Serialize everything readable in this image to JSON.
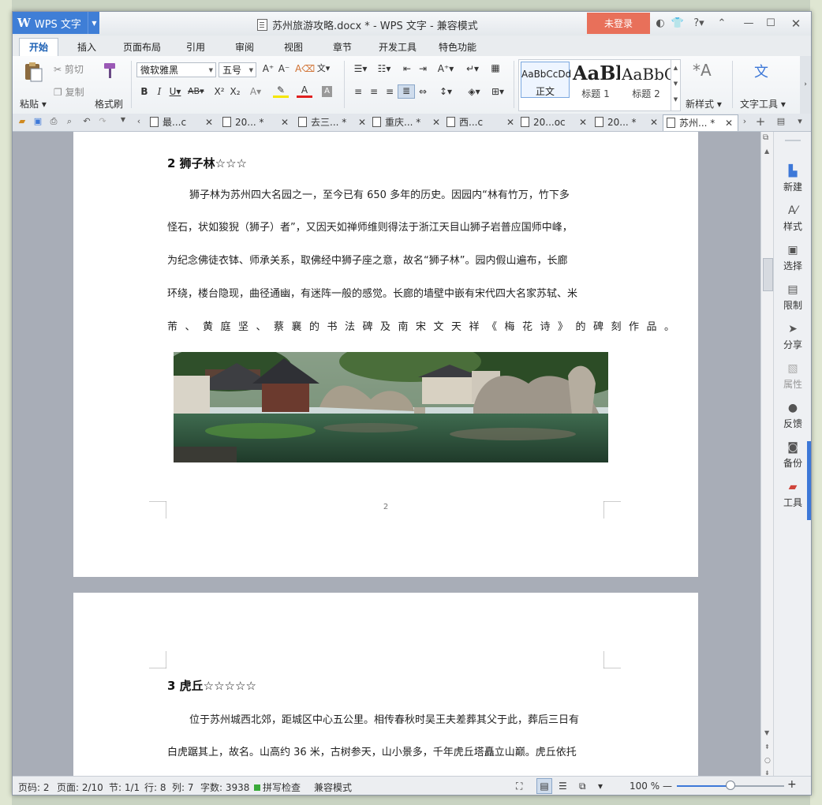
{
  "app": {
    "logo": "W",
    "name": "WPS 文字",
    "title": "苏州旅游攻略.docx * - WPS 文字 - 兼容模式",
    "login": "未登录"
  },
  "menu": {
    "tabs": [
      "开始",
      "插入",
      "页面布局",
      "引用",
      "审阅",
      "视图",
      "章节",
      "开发工具",
      "特色功能"
    ]
  },
  "ribbon": {
    "paste": "粘贴",
    "cut": "剪切",
    "copy": "复制",
    "format_painter": "格式刷",
    "font_name": "微软雅黑",
    "font_size": "五号",
    "styles": [
      {
        "preview": "AaBbCcDd",
        "name": "正文"
      },
      {
        "preview": "AaBb",
        "name": "标题 1"
      },
      {
        "preview": "AaBbC",
        "name": "标题 2"
      }
    ],
    "new_style": "新样式",
    "text_tools": "文字工具"
  },
  "doc_tabs": [
    {
      "label": "最...c"
    },
    {
      "label": "20... *"
    },
    {
      "label": "去三... *"
    },
    {
      "label": "重庆... *"
    },
    {
      "label": "西...c"
    },
    {
      "label": "20...oc"
    },
    {
      "label": "20... *"
    },
    {
      "label": "苏州... *",
      "active": true
    }
  ],
  "document": {
    "section2": {
      "heading": "2 狮子林☆☆☆",
      "lines": [
        "狮子林为苏州四大名园之一，至今已有 650 多年的历史。因园内“林有竹万，竹下多",
        "怪石，状如狻猊（狮子）者”，又因天如禅师维则得法于浙江天目山狮子岩普应国师中峰，",
        "为纪念佛徒衣钵、师承关系，取佛经中狮子座之意，故名“狮子林”。园内假山遍布，长廊",
        "环绕，楼台隐现，曲径通幽，有迷阵一般的感觉。长廊的墙壁中嵌有宋代四大名家苏轼、米",
        "芾、黄庭坚、蔡襄的书法碑及南宋文天祥《梅花诗》的碑刻作品。"
      ]
    },
    "page_number": "2",
    "section3": {
      "heading": "3 虎丘☆☆☆☆☆",
      "lines": [
        "位于苏州城西北郊，距城区中心五公里。相传春秋时吴王夫差葬其父于此，葬后三日有",
        "白虎踞其上，故名。山高约 36 米，古树参天，山小景多，千年虎丘塔矗立山巅。虎丘依托"
      ]
    }
  },
  "right_panel": [
    "新建",
    "样式",
    "选择",
    "限制",
    "分享",
    "属性",
    "反馈",
    "备份",
    "工具"
  ],
  "status": {
    "page_code": "页码: 2",
    "pages": "页面: 2/10",
    "section": "节: 1/1",
    "row": "行: 8",
    "col": "列: 7",
    "words": "字数: 3938",
    "spell": "拼写检查",
    "mode": "兼容模式",
    "zoom": "100 %"
  }
}
